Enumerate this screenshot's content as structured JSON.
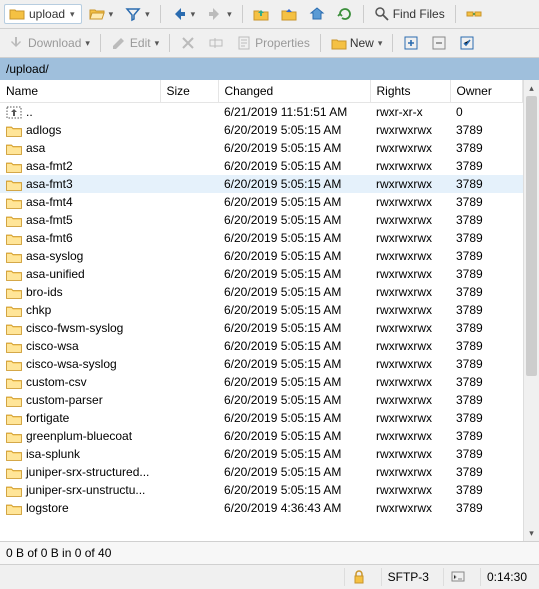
{
  "toolbar1": {
    "address_label": "upload",
    "find_label": "Find Files"
  },
  "toolbar2": {
    "download_label": "Download",
    "edit_label": "Edit",
    "properties_label": "Properties",
    "new_label": "New"
  },
  "pathbar": {
    "path": "/upload/"
  },
  "columns": {
    "name": "Name",
    "size": "Size",
    "changed": "Changed",
    "rights": "Rights",
    "owner": "Owner"
  },
  "rows": [
    {
      "type": "up",
      "name": "..",
      "size": "",
      "changed": "6/21/2019 11:51:51 AM",
      "rights": "rwxr-xr-x",
      "owner": "0",
      "selected": false
    },
    {
      "type": "dir",
      "name": "adlogs",
      "size": "",
      "changed": "6/20/2019 5:05:15 AM",
      "rights": "rwxrwxrwx",
      "owner": "3789",
      "selected": false
    },
    {
      "type": "dir",
      "name": "asa",
      "size": "",
      "changed": "6/20/2019 5:05:15 AM",
      "rights": "rwxrwxrwx",
      "owner": "3789",
      "selected": false
    },
    {
      "type": "dir",
      "name": "asa-fmt2",
      "size": "",
      "changed": "6/20/2019 5:05:15 AM",
      "rights": "rwxrwxrwx",
      "owner": "3789",
      "selected": false
    },
    {
      "type": "dir",
      "name": "asa-fmt3",
      "size": "",
      "changed": "6/20/2019 5:05:15 AM",
      "rights": "rwxrwxrwx",
      "owner": "3789",
      "selected": true
    },
    {
      "type": "dir",
      "name": "asa-fmt4",
      "size": "",
      "changed": "6/20/2019 5:05:15 AM",
      "rights": "rwxrwxrwx",
      "owner": "3789",
      "selected": false
    },
    {
      "type": "dir",
      "name": "asa-fmt5",
      "size": "",
      "changed": "6/20/2019 5:05:15 AM",
      "rights": "rwxrwxrwx",
      "owner": "3789",
      "selected": false
    },
    {
      "type": "dir",
      "name": "asa-fmt6",
      "size": "",
      "changed": "6/20/2019 5:05:15 AM",
      "rights": "rwxrwxrwx",
      "owner": "3789",
      "selected": false
    },
    {
      "type": "dir",
      "name": "asa-syslog",
      "size": "",
      "changed": "6/20/2019 5:05:15 AM",
      "rights": "rwxrwxrwx",
      "owner": "3789",
      "selected": false
    },
    {
      "type": "dir",
      "name": "asa-unified",
      "size": "",
      "changed": "6/20/2019 5:05:15 AM",
      "rights": "rwxrwxrwx",
      "owner": "3789",
      "selected": false
    },
    {
      "type": "dir",
      "name": "bro-ids",
      "size": "",
      "changed": "6/20/2019 5:05:15 AM",
      "rights": "rwxrwxrwx",
      "owner": "3789",
      "selected": false
    },
    {
      "type": "dir",
      "name": "chkp",
      "size": "",
      "changed": "6/20/2019 5:05:15 AM",
      "rights": "rwxrwxrwx",
      "owner": "3789",
      "selected": false
    },
    {
      "type": "dir",
      "name": "cisco-fwsm-syslog",
      "size": "",
      "changed": "6/20/2019 5:05:15 AM",
      "rights": "rwxrwxrwx",
      "owner": "3789",
      "selected": false
    },
    {
      "type": "dir",
      "name": "cisco-wsa",
      "size": "",
      "changed": "6/20/2019 5:05:15 AM",
      "rights": "rwxrwxrwx",
      "owner": "3789",
      "selected": false
    },
    {
      "type": "dir",
      "name": "cisco-wsa-syslog",
      "size": "",
      "changed": "6/20/2019 5:05:15 AM",
      "rights": "rwxrwxrwx",
      "owner": "3789",
      "selected": false
    },
    {
      "type": "dir",
      "name": "custom-csv",
      "size": "",
      "changed": "6/20/2019 5:05:15 AM",
      "rights": "rwxrwxrwx",
      "owner": "3789",
      "selected": false
    },
    {
      "type": "dir",
      "name": "custom-parser",
      "size": "",
      "changed": "6/20/2019 5:05:15 AM",
      "rights": "rwxrwxrwx",
      "owner": "3789",
      "selected": false
    },
    {
      "type": "dir",
      "name": "fortigate",
      "size": "",
      "changed": "6/20/2019 5:05:15 AM",
      "rights": "rwxrwxrwx",
      "owner": "3789",
      "selected": false
    },
    {
      "type": "dir",
      "name": "greenplum-bluecoat",
      "size": "",
      "changed": "6/20/2019 5:05:15 AM",
      "rights": "rwxrwxrwx",
      "owner": "3789",
      "selected": false
    },
    {
      "type": "dir",
      "name": "isa-splunk",
      "size": "",
      "changed": "6/20/2019 5:05:15 AM",
      "rights": "rwxrwxrwx",
      "owner": "3789",
      "selected": false
    },
    {
      "type": "dir",
      "name": "juniper-srx-structured...",
      "size": "",
      "changed": "6/20/2019 5:05:15 AM",
      "rights": "rwxrwxrwx",
      "owner": "3789",
      "selected": false
    },
    {
      "type": "dir",
      "name": "juniper-srx-unstructu...",
      "size": "",
      "changed": "6/20/2019 5:05:15 AM",
      "rights": "rwxrwxrwx",
      "owner": "3789",
      "selected": false
    },
    {
      "type": "dir",
      "name": "logstore",
      "size": "",
      "changed": "6/20/2019 4:36:43 AM",
      "rights": "rwxrwxrwx",
      "owner": "3789",
      "selected": false
    }
  ],
  "status": {
    "text": "0 B of 0 B in 0 of 40"
  },
  "footer": {
    "protocol": "SFTP-3",
    "elapsed": "0:14:30"
  }
}
